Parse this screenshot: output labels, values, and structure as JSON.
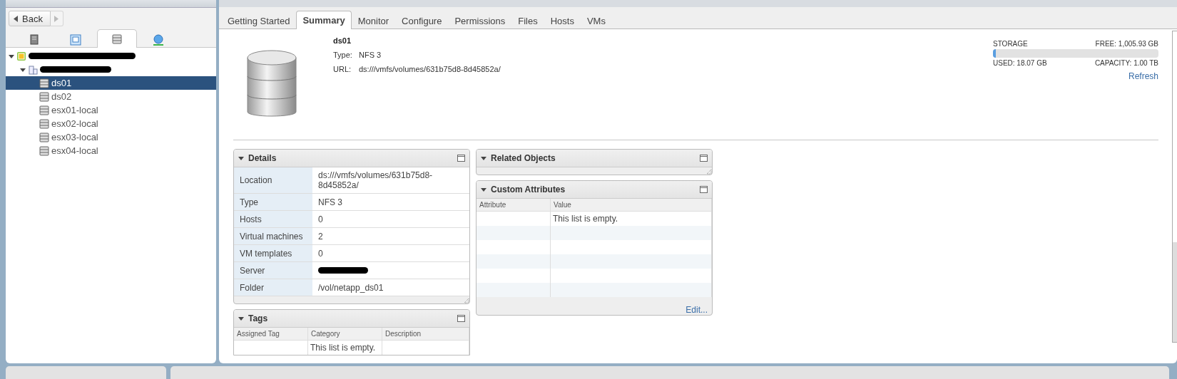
{
  "navigator": {
    "back_button": "Back",
    "object_tabs": [
      {
        "kind": "hosts",
        "selected": false
      },
      {
        "kind": "vms",
        "selected": false
      },
      {
        "kind": "storage",
        "selected": true
      },
      {
        "kind": "network",
        "selected": false
      }
    ],
    "tree": [
      {
        "kind": "vcenter",
        "expanded": true,
        "children": [
          {
            "kind": "datacenter",
            "expanded": true,
            "children": [
              {
                "kind": "datastore",
                "label": "ds01",
                "selected": true
              },
              {
                "kind": "datastore",
                "label": "ds02",
                "selected": false
              },
              {
                "kind": "datastore",
                "label": "esx01-local",
                "selected": false
              },
              {
                "kind": "datastore",
                "label": "esx02-local",
                "selected": false
              },
              {
                "kind": "datastore",
                "label": "esx03-local",
                "selected": false
              },
              {
                "kind": "datastore",
                "label": "esx04-local",
                "selected": false
              }
            ]
          }
        ]
      }
    ]
  },
  "tabs": [
    {
      "label": "Getting Started",
      "selected": false
    },
    {
      "label": "Summary",
      "selected": true
    },
    {
      "label": "Monitor",
      "selected": false
    },
    {
      "label": "Configure",
      "selected": false
    },
    {
      "label": "Permissions",
      "selected": false
    },
    {
      "label": "Files",
      "selected": false
    },
    {
      "label": "Hosts",
      "selected": false
    },
    {
      "label": "VMs",
      "selected": false
    }
  ],
  "summary": {
    "name": "ds01",
    "fields": [
      {
        "label": "Type:",
        "value": "NFS 3"
      },
      {
        "label": "URL:",
        "value": "ds:///vmfs/volumes/631b75d8-8d45852a/"
      }
    ],
    "storage": {
      "title": "STORAGE",
      "free": "FREE: 1,005.93 GB",
      "used": "USED: 18.07 GB",
      "capacity": "CAPACITY: 1.00 TB",
      "level": 0.018,
      "refresh": "Refresh"
    }
  },
  "details": {
    "title": "Details",
    "expanded": true,
    "rows": [
      {
        "label": "Location",
        "value": "ds:///vmfs/volumes/631b75d8-8d45852a/"
      },
      {
        "label": "Type",
        "value": "NFS 3"
      },
      {
        "label": "Hosts",
        "value": "0"
      },
      {
        "label": "Virtual machines",
        "value": "2"
      },
      {
        "label": "VM templates",
        "value": "0"
      },
      {
        "label": "Server",
        "kind": "redacted"
      },
      {
        "label": "Folder",
        "value": "/vol/netapp_ds01"
      }
    ]
  },
  "related_objects": {
    "title": "Related Objects",
    "expanded": true
  },
  "custom_attributes": {
    "title": "Custom Attributes",
    "expanded": true,
    "columns": [
      "Attribute",
      "Value"
    ],
    "empty_text": "This list is empty.",
    "link": "Edit..."
  },
  "tags": {
    "title": "Tags",
    "expanded": true,
    "columns": [
      "Assigned Tag",
      "Category",
      "Description"
    ],
    "empty_text": "This list is empty."
  }
}
